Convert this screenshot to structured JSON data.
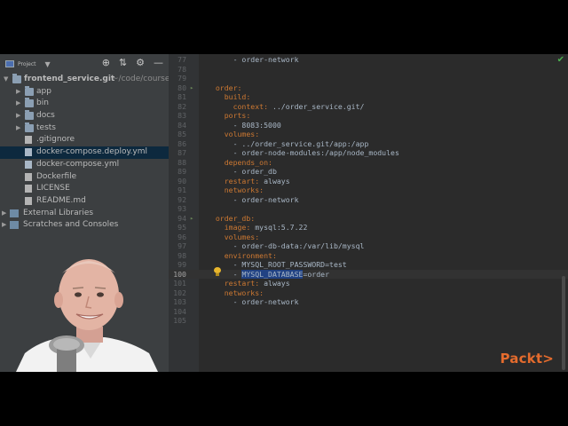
{
  "sidebar": {
    "header_label": "Project",
    "tree": [
      {
        "name": "frontend_service.git",
        "path": "~/code/course",
        "type": "folder",
        "depth": 0,
        "expanded": true
      },
      {
        "name": "app",
        "type": "folder",
        "depth": 1
      },
      {
        "name": "bin",
        "type": "folder",
        "depth": 1
      },
      {
        "name": "docs",
        "type": "folder",
        "depth": 1
      },
      {
        "name": "tests",
        "type": "folder",
        "depth": 1
      },
      {
        "name": ".gitignore",
        "type": "file",
        "depth": 1
      },
      {
        "name": "docker-compose.deploy.yml",
        "type": "yml",
        "depth": 1,
        "selected": true
      },
      {
        "name": "docker-compose.yml",
        "type": "yml",
        "depth": 1
      },
      {
        "name": "Dockerfile",
        "type": "file",
        "depth": 1
      },
      {
        "name": "LICENSE",
        "type": "file",
        "depth": 1
      },
      {
        "name": "README.md",
        "type": "file",
        "depth": 1
      },
      {
        "name": "External Libraries",
        "type": "lib",
        "depth": 0
      },
      {
        "name": "Scratches and Consoles",
        "type": "lib",
        "depth": 0
      }
    ]
  },
  "editor": {
    "current_line": 100,
    "lines": [
      {
        "n": "77",
        "text": "      - order-network"
      },
      {
        "n": "78",
        "text": ""
      },
      {
        "n": "79",
        "text": ""
      },
      {
        "n": "80",
        "text": "  order:",
        "key": "order",
        "fold": true
      },
      {
        "n": "81",
        "text": "    build:",
        "key": "build"
      },
      {
        "n": "82",
        "text": "      context: ../order_service.git/",
        "key": "context"
      },
      {
        "n": "83",
        "text": "    ports:",
        "key": "ports"
      },
      {
        "n": "84",
        "text": "      - 8083:5000"
      },
      {
        "n": "85",
        "text": "    volumes:",
        "key": "volumes"
      },
      {
        "n": "86",
        "text": "      - ../order_service.git/app:/app"
      },
      {
        "n": "87",
        "text": "      - order-node-modules:/app/node_modules"
      },
      {
        "n": "88",
        "text": "    depends_on:",
        "key": "depends_on"
      },
      {
        "n": "89",
        "text": "      - order_db"
      },
      {
        "n": "90",
        "text": "    restart: always",
        "key": "restart"
      },
      {
        "n": "91",
        "text": "    networks:",
        "key": "networks"
      },
      {
        "n": "92",
        "text": "      - order-network"
      },
      {
        "n": "93",
        "text": ""
      },
      {
        "n": "94",
        "text": "  order_db:",
        "key": "order_db",
        "fold": true
      },
      {
        "n": "95",
        "text": "    image: mysql:5.7.22",
        "key": "image"
      },
      {
        "n": "96",
        "text": "    volumes:",
        "key": "volumes"
      },
      {
        "n": "97",
        "text": "      - order-db-data:/var/lib/mysql"
      },
      {
        "n": "98",
        "text": "    environment:",
        "key": "environment"
      },
      {
        "n": "99",
        "text": "      - MYSQL_ROOT_PASSWORD=test"
      },
      {
        "n": "100",
        "text": "      - MYSQL_DATABASE=order",
        "selected": "MYSQL_DATABASE"
      },
      {
        "n": "101",
        "text": "    restart: always",
        "key": "restart"
      },
      {
        "n": "102",
        "text": "    networks:",
        "key": "networks"
      },
      {
        "n": "103",
        "text": "      - order-network"
      },
      {
        "n": "104",
        "text": ""
      },
      {
        "n": "105",
        "text": ""
      }
    ]
  },
  "watermark": "Packt>",
  "colors": {
    "editor_bg": "#2b2b2b",
    "sidebar_bg": "#3c3f41",
    "selection": "#0d293e",
    "yaml_key": "#cc7832",
    "brand": "#e46b2d"
  }
}
